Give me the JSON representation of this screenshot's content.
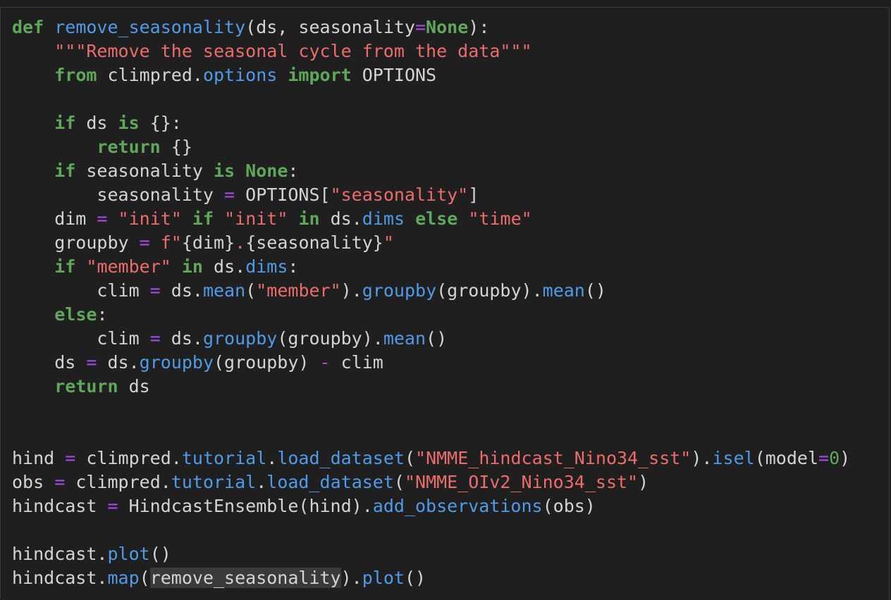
{
  "colors": {
    "background": "#1f1f1f",
    "keyword": "#5fa85a",
    "function": "#4f9be8",
    "string": "#ec6c6c",
    "operator": "#a64be8",
    "text": "#d4d4d4",
    "selection": "#3a3a3a"
  },
  "code_lines": [
    [
      [
        "kw",
        "def"
      ],
      [
        "plain",
        " "
      ],
      [
        "fn",
        "remove_seasonality"
      ],
      [
        "plain",
        "(ds, seasonality"
      ],
      [
        "op",
        "="
      ],
      [
        "kw",
        "None"
      ],
      [
        "plain",
        "):"
      ]
    ],
    [
      [
        "plain",
        "    "
      ],
      [
        "str",
        "\"\"\"Remove the seasonal cycle from the data\"\"\""
      ]
    ],
    [
      [
        "plain",
        "    "
      ],
      [
        "kw",
        "from"
      ],
      [
        "plain",
        " climpred."
      ],
      [
        "fn",
        "options"
      ],
      [
        "plain",
        " "
      ],
      [
        "kw",
        "import"
      ],
      [
        "plain",
        " OPTIONS"
      ]
    ],
    [
      [
        "plain",
        ""
      ]
    ],
    [
      [
        "plain",
        "    "
      ],
      [
        "kw",
        "if"
      ],
      [
        "plain",
        " ds "
      ],
      [
        "kw",
        "is"
      ],
      [
        "plain",
        " {}:"
      ]
    ],
    [
      [
        "plain",
        "        "
      ],
      [
        "kw",
        "return"
      ],
      [
        "plain",
        " {}"
      ]
    ],
    [
      [
        "plain",
        "    "
      ],
      [
        "kw",
        "if"
      ],
      [
        "plain",
        " seasonality "
      ],
      [
        "kw",
        "is"
      ],
      [
        "plain",
        " "
      ],
      [
        "kw",
        "None"
      ],
      [
        "plain",
        ":"
      ]
    ],
    [
      [
        "plain",
        "        seasonality "
      ],
      [
        "op",
        "="
      ],
      [
        "plain",
        " OPTIONS["
      ],
      [
        "str",
        "\"seasonality\""
      ],
      [
        "plain",
        "]"
      ]
    ],
    [
      [
        "plain",
        "    dim "
      ],
      [
        "op",
        "="
      ],
      [
        "plain",
        " "
      ],
      [
        "str",
        "\"init\""
      ],
      [
        "plain",
        " "
      ],
      [
        "kw",
        "if"
      ],
      [
        "plain",
        " "
      ],
      [
        "str",
        "\"init\""
      ],
      [
        "plain",
        " "
      ],
      [
        "kw",
        "in"
      ],
      [
        "plain",
        " ds."
      ],
      [
        "fn",
        "dims"
      ],
      [
        "plain",
        " "
      ],
      [
        "kw",
        "else"
      ],
      [
        "plain",
        " "
      ],
      [
        "str",
        "\"time\""
      ]
    ],
    [
      [
        "plain",
        "    groupby "
      ],
      [
        "op",
        "="
      ],
      [
        "plain",
        " "
      ],
      [
        "str",
        "f\""
      ],
      [
        "plain",
        "{dim}"
      ],
      [
        "str",
        "."
      ],
      [
        "plain",
        "{seasonality}"
      ],
      [
        "str",
        "\""
      ]
    ],
    [
      [
        "plain",
        "    "
      ],
      [
        "kw",
        "if"
      ],
      [
        "plain",
        " "
      ],
      [
        "str",
        "\"member\""
      ],
      [
        "plain",
        " "
      ],
      [
        "kw",
        "in"
      ],
      [
        "plain",
        " ds."
      ],
      [
        "fn",
        "dims"
      ],
      [
        "plain",
        ":"
      ]
    ],
    [
      [
        "plain",
        "        clim "
      ],
      [
        "op",
        "="
      ],
      [
        "plain",
        " ds."
      ],
      [
        "fn",
        "mean"
      ],
      [
        "plain",
        "("
      ],
      [
        "str",
        "\"member\""
      ],
      [
        "plain",
        ")."
      ],
      [
        "fn",
        "groupby"
      ],
      [
        "plain",
        "(groupby)."
      ],
      [
        "fn",
        "mean"
      ],
      [
        "plain",
        "()"
      ]
    ],
    [
      [
        "plain",
        "    "
      ],
      [
        "kw",
        "else"
      ],
      [
        "plain",
        ":"
      ]
    ],
    [
      [
        "plain",
        "        clim "
      ],
      [
        "op",
        "="
      ],
      [
        "plain",
        " ds."
      ],
      [
        "fn",
        "groupby"
      ],
      [
        "plain",
        "(groupby)."
      ],
      [
        "fn",
        "mean"
      ],
      [
        "plain",
        "()"
      ]
    ],
    [
      [
        "plain",
        "    ds "
      ],
      [
        "op",
        "="
      ],
      [
        "plain",
        " ds."
      ],
      [
        "fn",
        "groupby"
      ],
      [
        "plain",
        "(groupby) "
      ],
      [
        "op",
        "-"
      ],
      [
        "plain",
        " clim"
      ]
    ],
    [
      [
        "plain",
        "    "
      ],
      [
        "kw",
        "return"
      ],
      [
        "plain",
        " ds"
      ]
    ],
    [
      [
        "plain",
        ""
      ]
    ],
    [
      [
        "plain",
        ""
      ]
    ],
    [
      [
        "plain",
        "hind "
      ],
      [
        "op",
        "="
      ],
      [
        "plain",
        " climpred."
      ],
      [
        "fn",
        "tutorial"
      ],
      [
        "plain",
        "."
      ],
      [
        "fn",
        "load_dataset"
      ],
      [
        "plain",
        "("
      ],
      [
        "str",
        "\"NMME_hindcast_Nino34_sst\""
      ],
      [
        "plain",
        ")."
      ],
      [
        "fn",
        "isel"
      ],
      [
        "plain",
        "(model"
      ],
      [
        "op",
        "="
      ],
      [
        "num",
        "0"
      ],
      [
        "plain",
        ")"
      ]
    ],
    [
      [
        "plain",
        "obs "
      ],
      [
        "op",
        "="
      ],
      [
        "plain",
        " climpred."
      ],
      [
        "fn",
        "tutorial"
      ],
      [
        "plain",
        "."
      ],
      [
        "fn",
        "load_dataset"
      ],
      [
        "plain",
        "("
      ],
      [
        "str",
        "\"NMME_OIv2_Nino34_sst\""
      ],
      [
        "plain",
        ")"
      ]
    ],
    [
      [
        "plain",
        "hindcast "
      ],
      [
        "op",
        "="
      ],
      [
        "plain",
        " HindcastEnsemble(hind)."
      ],
      [
        "fn",
        "add_observations"
      ],
      [
        "plain",
        "(obs)"
      ]
    ],
    [
      [
        "plain",
        ""
      ]
    ],
    [
      [
        "plain",
        "hindcast."
      ],
      [
        "fn",
        "plot"
      ],
      [
        "plain",
        "()"
      ]
    ],
    [
      [
        "plain",
        "hindcast."
      ],
      [
        "fn",
        "map"
      ],
      [
        "plain",
        "("
      ],
      [
        "hl",
        "remove_seasonality"
      ],
      [
        "plain",
        ")."
      ],
      [
        "fn",
        "plot"
      ],
      [
        "plain",
        "()"
      ]
    ]
  ]
}
